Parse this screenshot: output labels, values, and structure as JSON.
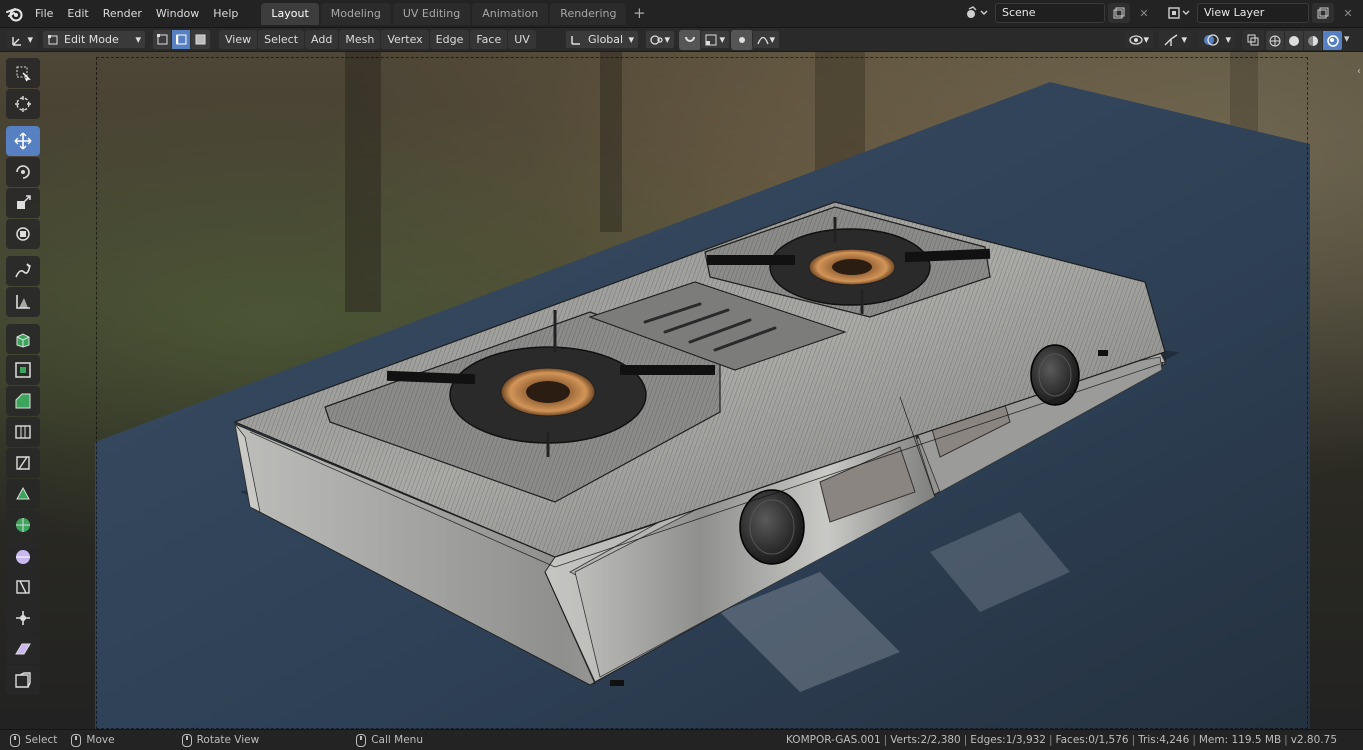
{
  "topbar": {
    "menus": [
      "File",
      "Edit",
      "Render",
      "Window",
      "Help"
    ],
    "workspace_tabs": [
      {
        "label": "Layout",
        "active": true
      },
      {
        "label": "Modeling",
        "active": false
      },
      {
        "label": "UV Editing",
        "active": false
      },
      {
        "label": "Animation",
        "active": false
      },
      {
        "label": "Rendering",
        "active": false
      }
    ],
    "scene_name": "Scene",
    "view_layer_name": "View Layer"
  },
  "header": {
    "mode": "Edit Mode",
    "menus": [
      "View",
      "Select",
      "Add",
      "Mesh",
      "Vertex",
      "Edge",
      "Face",
      "UV"
    ],
    "transform_orientation": "Global"
  },
  "toolbar": {
    "tools": [
      {
        "icon": "select-box-icon",
        "active": false
      },
      {
        "icon": "cursor-icon",
        "active": false
      },
      {
        "icon": "move-icon",
        "active": true
      },
      {
        "icon": "rotate-icon",
        "active": false
      },
      {
        "icon": "scale-icon",
        "active": false
      },
      {
        "icon": "transform-icon",
        "active": false
      },
      {
        "icon": "annotate-icon",
        "active": false
      },
      {
        "icon": "measure-icon",
        "active": false
      },
      {
        "icon": "extrude-icon",
        "active": false
      },
      {
        "icon": "inset-icon",
        "active": false
      },
      {
        "icon": "bevel-icon",
        "active": false
      },
      {
        "icon": "loop-cut-icon",
        "active": false
      },
      {
        "icon": "knife-icon",
        "active": false
      },
      {
        "icon": "poly-build-icon",
        "active": false
      },
      {
        "icon": "spin-icon",
        "active": false
      },
      {
        "icon": "smooth-icon",
        "active": false
      },
      {
        "icon": "edge-slide-icon",
        "active": false
      },
      {
        "icon": "shrink-fatten-icon",
        "active": false
      },
      {
        "icon": "shear-icon",
        "active": false
      },
      {
        "icon": "rip-region-icon",
        "active": false
      }
    ]
  },
  "statusbar": {
    "select": "Select",
    "move": "Move",
    "rotate_view": "Rotate View",
    "call_menu": "Call Menu",
    "object_name": "KOMPOR-GAS.001",
    "verts": "Verts:2/2,380",
    "edges": "Edges:1/3,932",
    "faces": "Faces:0/1,576",
    "tris": "Tris:4,246",
    "mem": "Mem: 119.5 MB",
    "version": "v2.80.75"
  },
  "colors": {
    "accent": "#5680c2",
    "table": "#2f3f52",
    "steel": "#a7a7a3",
    "burner": "#c98a4e"
  }
}
